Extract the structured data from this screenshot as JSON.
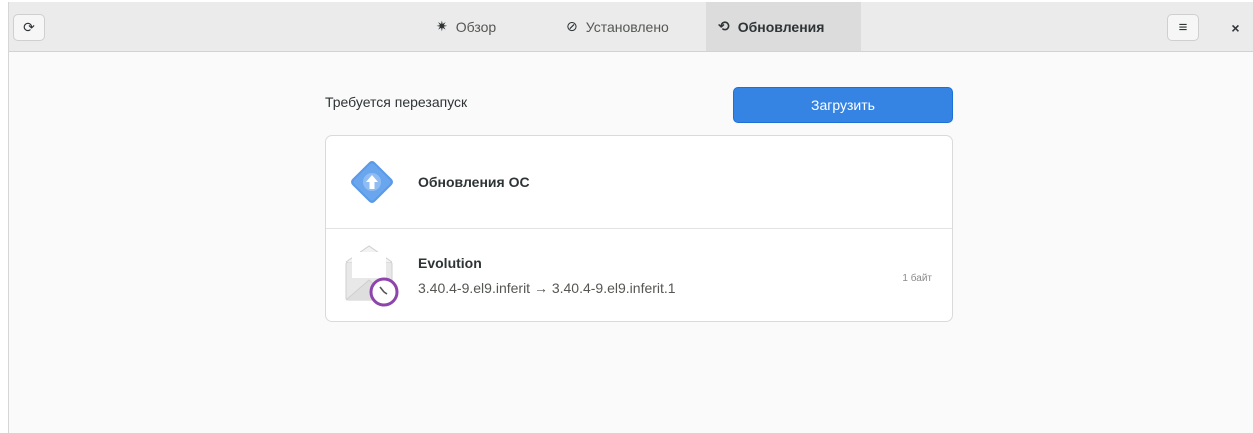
{
  "header": {
    "refresh_icon": "⟳",
    "tabs": [
      {
        "label": "Обзор",
        "icon": "✷"
      },
      {
        "label": "Установлено",
        "icon": "⊘"
      },
      {
        "label": "Обновления",
        "icon": "⟲"
      }
    ],
    "menu_icon": "≡",
    "close_icon": "×"
  },
  "main": {
    "section_title": "Требуется перезапуск",
    "download_label": "Загрузить",
    "updates": [
      {
        "name": "Обновления ОС"
      },
      {
        "name": "Evolution",
        "version": "3.40.4-9.el9.inferit → 3.40.4-9.el9.inferit.1",
        "size": "1 байт"
      }
    ]
  },
  "colors": {
    "accent": "#3584e4",
    "os_icon": "#5a9ae8",
    "evolution_clock": "#8e44ad"
  }
}
